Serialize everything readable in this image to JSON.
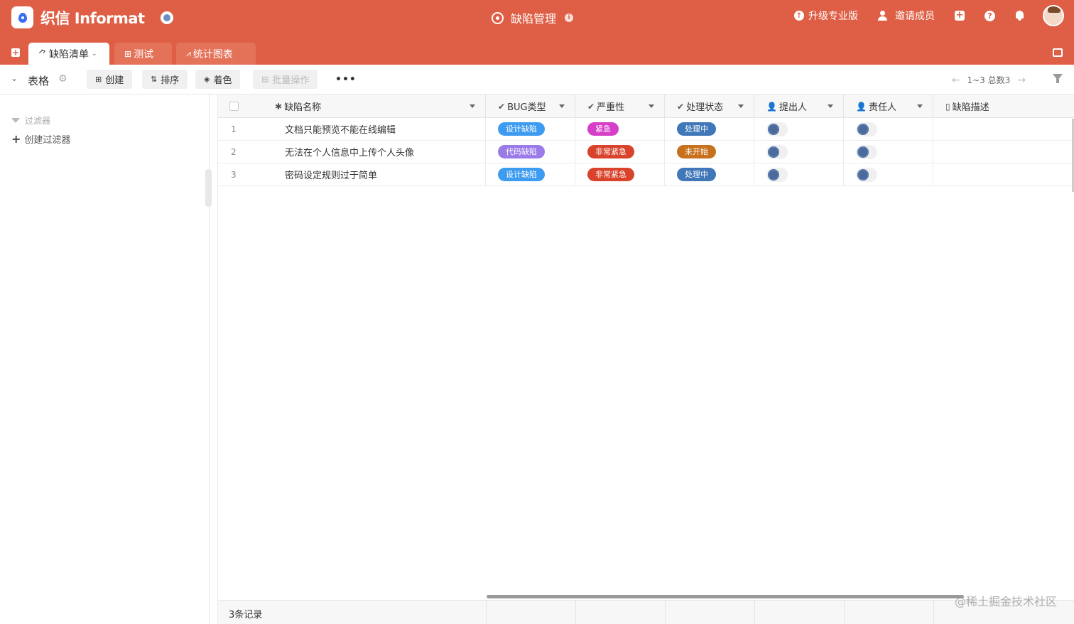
{
  "header": {
    "brand_name": "织信 Informat",
    "app_title": "缺陷管理",
    "actions": {
      "upgrade": "升级专业版",
      "invite": "邀请成员"
    }
  },
  "tabs": [
    {
      "label": "缺陷清单",
      "icon": "figure-icon"
    },
    {
      "label": "测试",
      "icon": "table-icon"
    },
    {
      "label": "统计图表",
      "icon": "chart-icon"
    }
  ],
  "toolbar": {
    "view_name": "表格",
    "create": "创建",
    "sort": "排序",
    "color": "着色",
    "batch": "批量操作",
    "more": "•••",
    "pager": "1~3 总数3"
  },
  "sidebar": {
    "filter_label": "过滤器",
    "create_filter": "创建过滤器"
  },
  "grid": {
    "columns": [
      {
        "label": "缺陷名称",
        "icon": "asterisk-icon"
      },
      {
        "label": "BUG类型",
        "icon": "check-circle-icon"
      },
      {
        "label": "严重性",
        "icon": "check-circle-icon"
      },
      {
        "label": "处理状态",
        "icon": "check-circle-icon"
      },
      {
        "label": "提出人",
        "icon": "user-icon"
      },
      {
        "label": "责任人",
        "icon": "user-icon"
      },
      {
        "label": "缺陷描述",
        "icon": "doc-icon"
      }
    ],
    "rows": [
      {
        "num": "1",
        "name": "文档只能预览不能在线编辑",
        "type": "设计缺陷",
        "severity": "紧急",
        "status": "处理中"
      },
      {
        "num": "2",
        "name": "无法在个人信息中上传个人头像",
        "type": "代码缺陷",
        "severity": "非常紧急",
        "status": "未开始"
      },
      {
        "num": "3",
        "name": "密码设定规则过于简单",
        "type": "设计缺陷",
        "severity": "非常紧急",
        "status": "处理中"
      }
    ],
    "footer_count": "3条记录"
  },
  "colors": {
    "header_bg": "#de5f45",
    "tag_design": "#3d9bf0",
    "tag_code": "#9b7be8",
    "tag_urgent": "#d63fc8",
    "tag_very_urgent": "#d9432b",
    "tag_processing": "#3f77b8",
    "tag_not_started": "#c7711c"
  },
  "watermark": "@稀土掘金技术社区"
}
